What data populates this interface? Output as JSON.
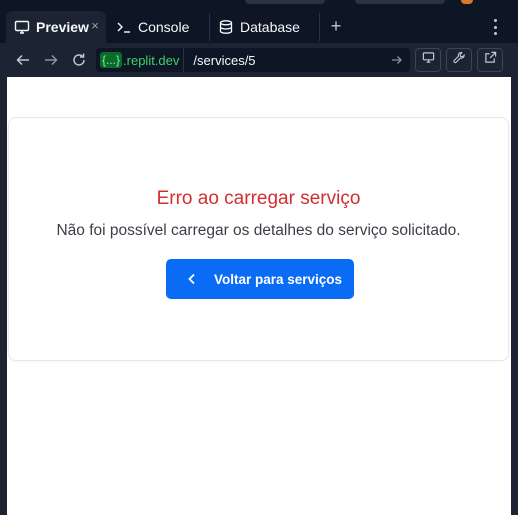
{
  "tabs": [
    {
      "label": "Preview",
      "icon": "monitor-icon",
      "active": true,
      "close": "×"
    },
    {
      "label": "Console",
      "icon": "terminal-icon",
      "active": false
    },
    {
      "label": "Database",
      "icon": "database-icon",
      "active": false
    }
  ],
  "add_tab": "+",
  "address": {
    "domain_prefix": "{...}",
    "domain_suffix": ".replit.dev",
    "path": "/services/5"
  },
  "page": {
    "error_title": "Erro ao carregar serviço",
    "error_message": "Não foi possível carregar os detalhes do serviço solicitado.",
    "back_button": "Voltar para serviços"
  },
  "colors": {
    "ide_bg": "#0e1525",
    "panel_bg": "#1c2333",
    "error_red": "#d12f2f",
    "primary_blue": "#0a6cf5",
    "domain_green": "#3fd26b"
  }
}
